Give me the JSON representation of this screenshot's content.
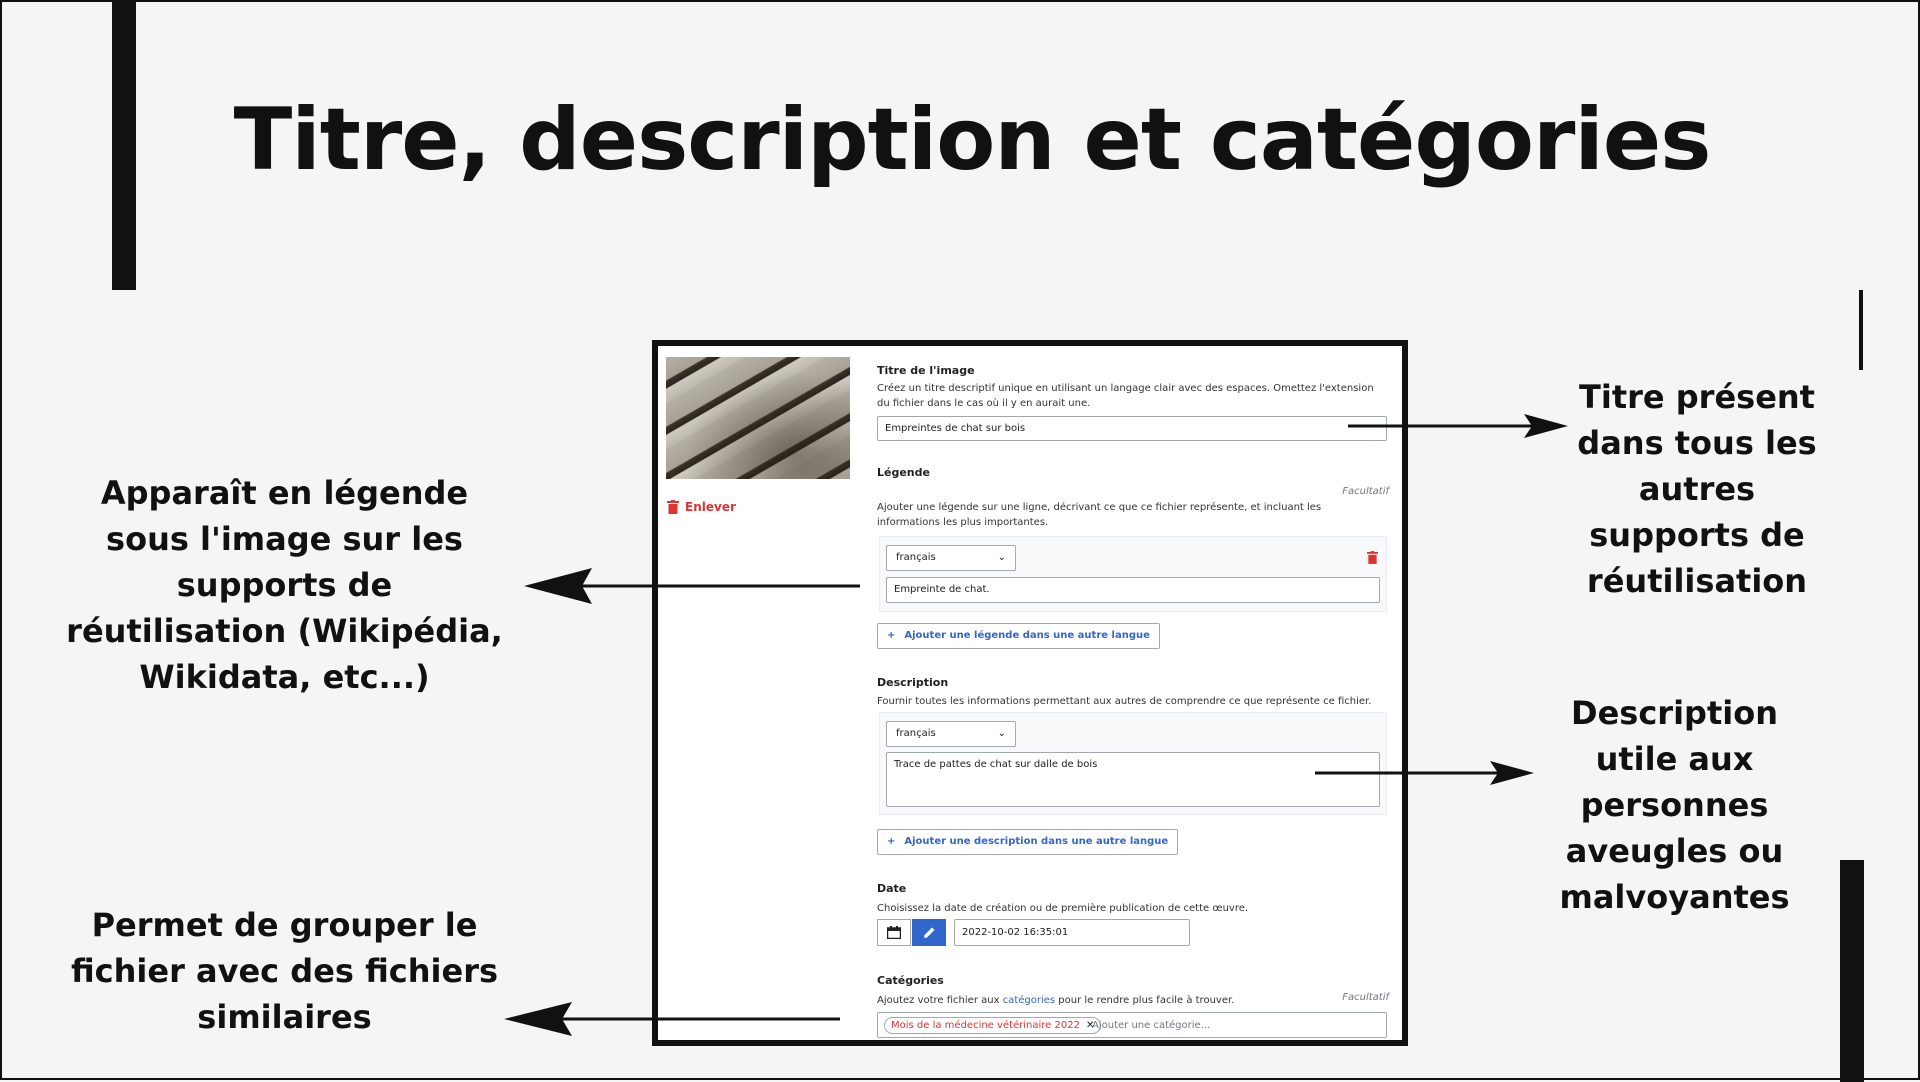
{
  "slide": {
    "title": "Titre, description et catégories",
    "notes": {
      "legende": "Apparaît en légende sous l'image sur les supports de réutilisation (Wikipédia, Wikidata, etc...)",
      "categories": "Permet de grouper le fichier avec des fichiers similaires",
      "titre": "Titre présent dans tous les autres supports de réutilisation",
      "description": "Description utile aux personnes aveugles ou malvoyantes"
    }
  },
  "form": {
    "remove_label": "Enlever",
    "title": {
      "label": "Titre de l'image",
      "help": "Créez un titre descriptif unique en utilisant un langage clair avec des espaces. Omettez l'extension du fichier dans le cas où il y en aurait une.",
      "value": "Empreintes de chat sur bois"
    },
    "caption": {
      "label": "Légende",
      "optional": "Facultatif",
      "help": "Ajouter une légende sur une ligne, décrivant ce que ce fichier représente, et incluant les informations les plus importantes.",
      "language": "français",
      "value": "Empreinte de chat.",
      "add_label": "Ajouter une légende dans une autre langue"
    },
    "description": {
      "label": "Description",
      "help": "Fournir toutes les informations permettant aux autres de comprendre ce que représente ce fichier.",
      "language": "français",
      "value": "Trace de pattes de chat sur dalle de bois",
      "add_label": "Ajouter une description dans une autre langue"
    },
    "date": {
      "label": "Date",
      "help": "Choisissez la date de création ou de première publication de cette œuvre.",
      "value": "2022-10-02 16:35:01"
    },
    "categories": {
      "label": "Catégories",
      "optional": "Facultatif",
      "help_before": "Ajoutez votre fichier aux ",
      "help_link": "catégories",
      "help_after": " pour le rendre plus facile à trouver.",
      "chip": "Mois de la médecine vétérinaire 2022",
      "placeholder": "Ajouter une catégorie..."
    }
  },
  "icons": {
    "trash": "trash-icon",
    "plus": "plus-icon",
    "chevron": "chevron-down-icon",
    "calendar": "calendar-icon",
    "pencil": "pencil-icon",
    "close": "close-icon",
    "arrow": "arrow-icon"
  },
  "colors": {
    "accent": "#3366cc",
    "danger": "#d33333",
    "text": "#111111",
    "background": "#f5f5f5"
  }
}
